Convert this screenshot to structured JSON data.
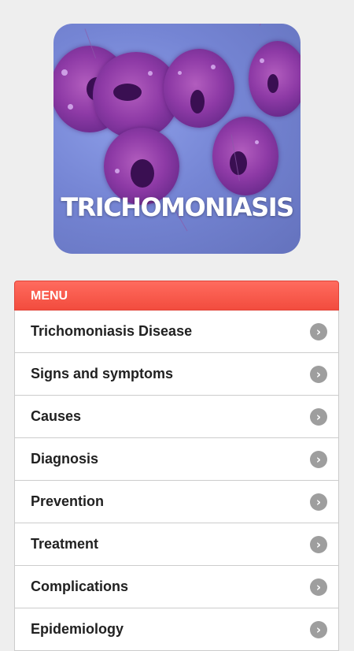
{
  "banner": {
    "title": "TRICHOMONIASIS"
  },
  "menu": {
    "header": "MENU",
    "items": [
      {
        "label": "Trichomoniasis Disease",
        "icon": "chevron-right-circle-icon"
      },
      {
        "label": "Signs and symptoms",
        "icon": "chevron-right-circle-icon"
      },
      {
        "label": "Causes",
        "icon": "chevron-right-circle-icon"
      },
      {
        "label": "Diagnosis",
        "icon": "chevron-right-circle-icon"
      },
      {
        "label": "Prevention",
        "icon": "chevron-right-circle-icon"
      },
      {
        "label": "Treatment",
        "icon": "chevron-right-circle-icon"
      },
      {
        "label": "Complications",
        "icon": "chevron-right-circle-icon"
      },
      {
        "label": "Epidemiology",
        "icon": "chevron-right-circle-icon"
      }
    ]
  },
  "colors": {
    "menu_header": "#f24c3e",
    "background": "#eeeeee",
    "chevron": "#9e9e9e"
  }
}
